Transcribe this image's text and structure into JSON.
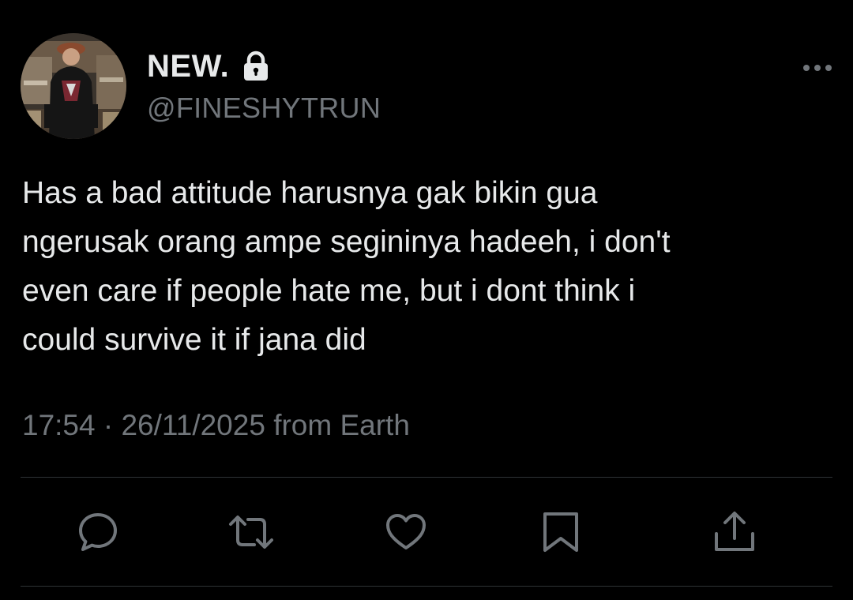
{
  "author": {
    "display_name": "NEW.",
    "handle": "@FINESHYTRUN",
    "protected_icon": "lock-icon",
    "avatar": "profile-photo"
  },
  "tweet": {
    "lines": [
      "Has a bad attitude harusnya gak bikin gua",
      "ngerusak orang ampe segininya hadeeh, i don't",
      "even care if people hate me, but i dont think i",
      "could survive it if jana did"
    ]
  },
  "meta": {
    "time": "17:54",
    "separator": "·",
    "date": "26/11/2025",
    "source": "from Earth"
  },
  "actions": [
    {
      "name": "reply",
      "icon": "reply-icon"
    },
    {
      "name": "retweet",
      "icon": "retweet-icon"
    },
    {
      "name": "like",
      "icon": "heart-icon"
    },
    {
      "name": "bookmark",
      "icon": "bookmark-icon"
    },
    {
      "name": "share",
      "icon": "share-icon"
    }
  ],
  "colors": {
    "background": "#000000",
    "primary_text": "#e7e9ea",
    "secondary_text": "#71767b",
    "divider": "#2f3336",
    "icon": "#71767b"
  }
}
